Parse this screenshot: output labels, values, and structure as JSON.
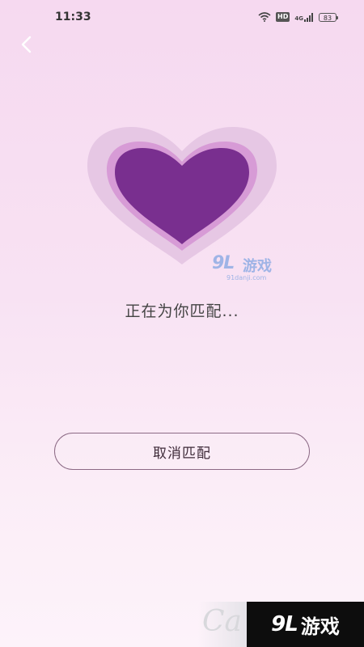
{
  "status_bar": {
    "time": "11:33",
    "hd_label": "HD",
    "signal_label": "4G",
    "battery_level": "83",
    "icons": [
      "wifi-icon",
      "hd-badge",
      "signal-icon",
      "battery-icon"
    ]
  },
  "header": {
    "back_icon": "chevron-left-icon"
  },
  "main": {
    "heart_icon": "heart-icon",
    "colors": {
      "heart_outer": "#e3c4e2",
      "heart_mid": "#d79bd6",
      "heart_inner": "#792f8f"
    },
    "matching_text": "正在为你匹配...",
    "cancel_label": "取消匹配"
  },
  "watermark": {
    "center_logo": "9L",
    "center_text": "游戏",
    "center_url": "91danji.com",
    "bottom_partial": "Ca",
    "bottom_logo": "9L",
    "bottom_text": "游戏"
  }
}
